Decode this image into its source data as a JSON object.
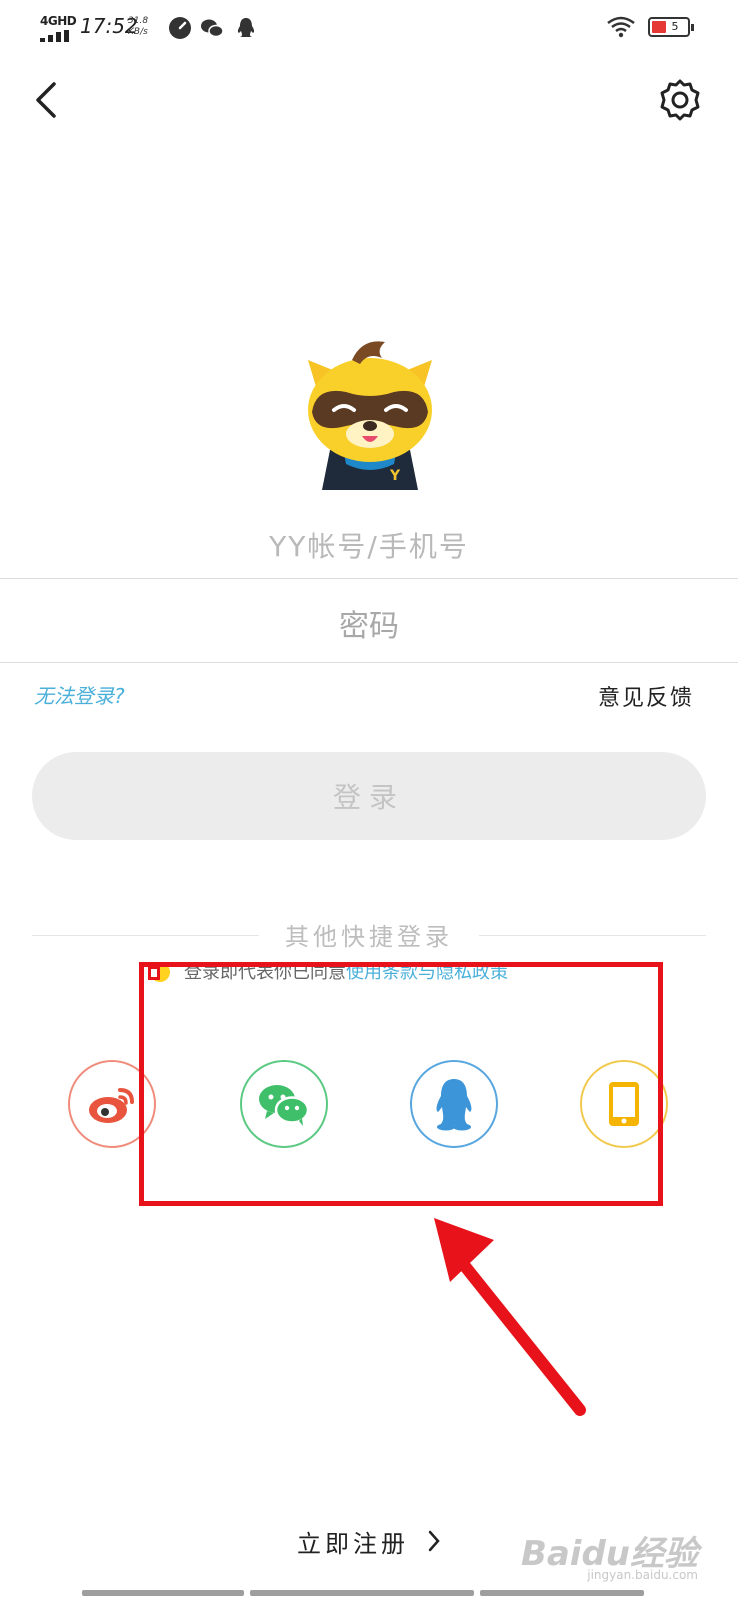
{
  "status_bar": {
    "network": "4GHD",
    "time": "17:52",
    "speed_value": "31.8",
    "speed_unit": "KB/s",
    "battery": "5"
  },
  "login": {
    "account_placeholder": "YY帐号/手机号",
    "password_placeholder": "密码",
    "forgot_link": "无法登录?",
    "feedback_link": "意见反馈",
    "login_button": "登录"
  },
  "quick_login": {
    "title": "其他快捷登录",
    "agreement_prefix": "登录即代表你已同意",
    "agreement_links": "使用条款与隐私政策",
    "providers": [
      "weibo",
      "wechat",
      "qq",
      "phone"
    ]
  },
  "register": {
    "label": "立即注册"
  },
  "watermark": {
    "text": "Baidu经验",
    "sub": "jingyan.baidu.com"
  },
  "colors": {
    "accent": "#4ab0da",
    "highlight": "#e8131a",
    "weibo": "#e8543d",
    "wechat": "#3fbf6a",
    "qq": "#3d95d9",
    "phone": "#f4b400"
  }
}
